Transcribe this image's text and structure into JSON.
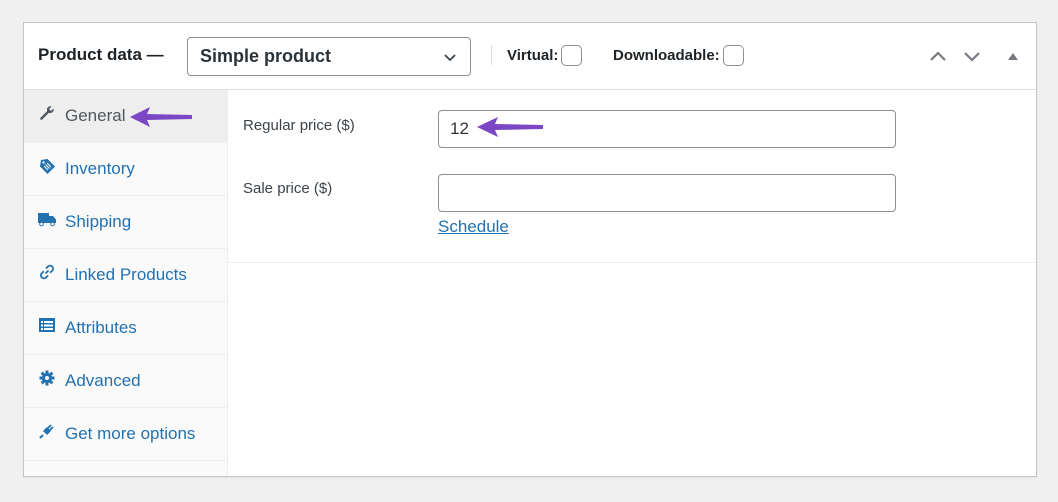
{
  "header": {
    "title": "Product data —",
    "product_type": {
      "selected": "Simple product",
      "icon": "chevron-down-icon"
    },
    "virtual": {
      "label": "Virtual:",
      "checked": false
    },
    "downloadable": {
      "label": "Downloadable:",
      "checked": false
    },
    "controls": [
      {
        "name": "move-up",
        "icon": "chevron-up-icon"
      },
      {
        "name": "move-down",
        "icon": "chevron-down-icon"
      },
      {
        "name": "toggle-panel",
        "icon": "triangle-up-icon"
      }
    ]
  },
  "sidebar": {
    "items": [
      {
        "label": "General",
        "icon": "wrench-icon",
        "active": true
      },
      {
        "label": "Inventory",
        "icon": "tag-icon",
        "active": false
      },
      {
        "label": "Shipping",
        "icon": "truck-icon",
        "active": false
      },
      {
        "label": "Linked Products",
        "icon": "link-icon",
        "active": false
      },
      {
        "label": "Attributes",
        "icon": "list-table-icon",
        "active": false
      },
      {
        "label": "Advanced",
        "icon": "gear-icon",
        "active": false
      },
      {
        "label": "Get more options",
        "icon": "plugin-icon",
        "active": false
      }
    ]
  },
  "general": {
    "regular_price": {
      "label": "Regular price ($)",
      "value": "12"
    },
    "sale_price": {
      "label": "Sale price ($)",
      "value": ""
    },
    "schedule_link": "Schedule"
  },
  "annotations": {
    "arrow_color": "#7b47c4"
  },
  "colors": {
    "link": "#2271b1",
    "active_tab_bg": "#eeeeee"
  }
}
